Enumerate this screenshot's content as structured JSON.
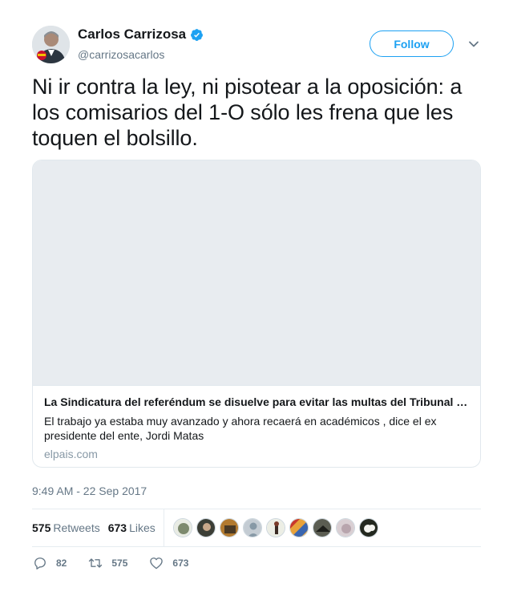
{
  "author": {
    "display_name": "Carlos Carrizosa",
    "handle": "@carrizosacarlos",
    "verified": true
  },
  "header": {
    "follow_label": "Follow"
  },
  "tweet": {
    "text": "Ni ir contra la ley, ni pisotear a la oposición: a los comisarios del 1-O sólo les frena que les toquen el bolsillo.",
    "timestamp": "9:49 AM - 22 Sep 2017"
  },
  "card": {
    "title": "La Sindicatura del referéndum se disuelve para evitar las multas del Tribunal …",
    "description": "El trabajo ya estaba muy avanzado y ahora recaerá en académicos , dice el ex presidente del ente, Jordi Matas",
    "domain": "elpais.com"
  },
  "stats": {
    "retweets_count": "575",
    "retweets_label": "Retweets",
    "likes_count": "673",
    "likes_label": "Likes"
  },
  "actions": {
    "reply_count": "82",
    "retweet_count": "575",
    "like_count": "673"
  },
  "colors": {
    "accent": "#1da1f2",
    "secondary_text": "#657786",
    "border": "#e1e8ed"
  }
}
